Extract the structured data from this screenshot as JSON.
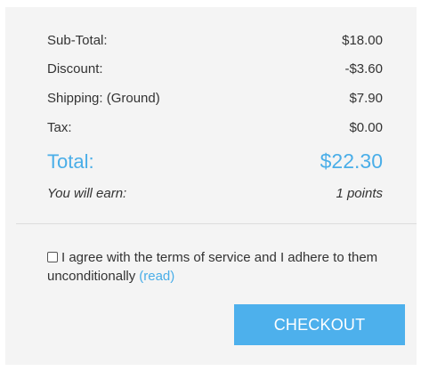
{
  "summary": {
    "subtotal": {
      "label": "Sub-Total:",
      "value": "$18.00"
    },
    "discount": {
      "label": "Discount:",
      "value": "-$3.60"
    },
    "shipping": {
      "label": "Shipping: (Ground)",
      "value": "$7.90"
    },
    "tax": {
      "label": "Tax:",
      "value": "$0.00"
    },
    "total": {
      "label": "Total:",
      "value": "$22.30"
    },
    "earn": {
      "label": "You will earn:",
      "value": "1 points"
    }
  },
  "terms": {
    "text": "I agree with the terms of service and I adhere to them unconditionally",
    "link": "(read)",
    "checked": false
  },
  "checkout_label": "CHECKOUT",
  "colors": {
    "accent": "#4aaee8",
    "button": "#4db0ec",
    "panel": "#f4f4f4"
  }
}
